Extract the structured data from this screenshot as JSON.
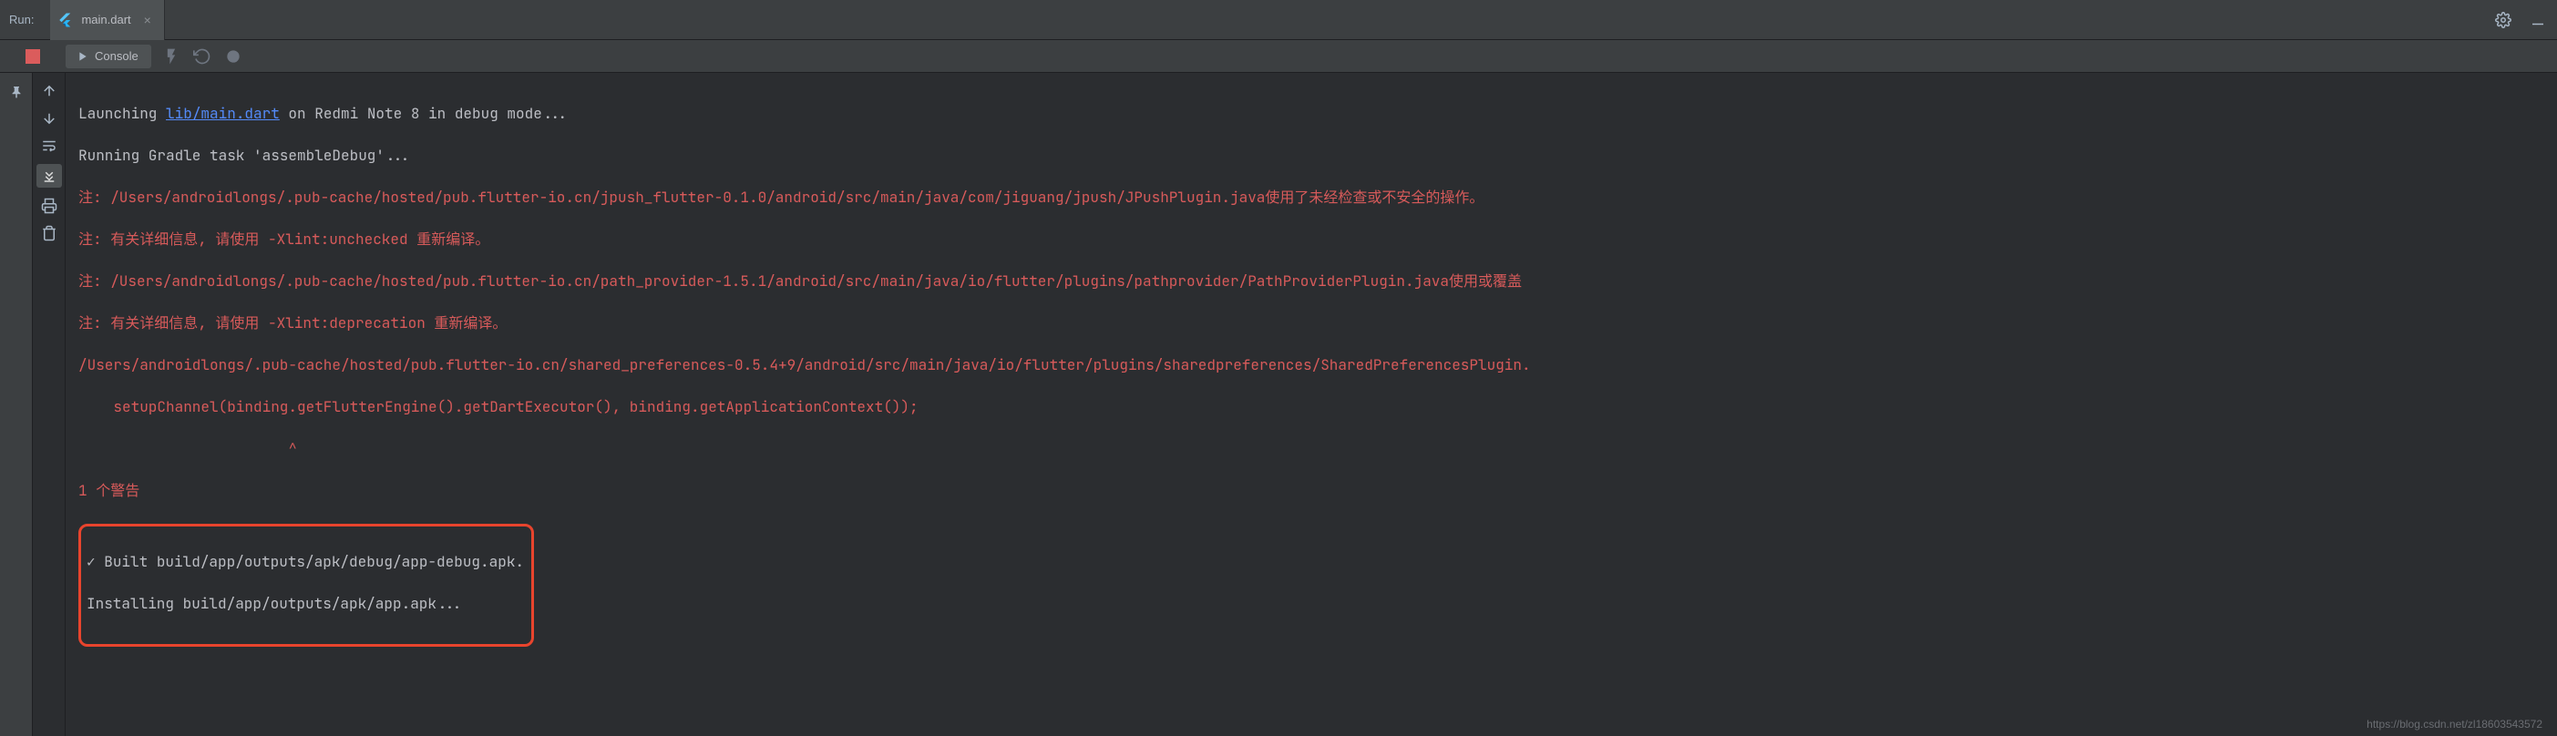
{
  "header": {
    "run_label": "Run:",
    "tab": {
      "name": "main.dart",
      "icon": "flutter-icon"
    }
  },
  "toolbar": {
    "console_label": "Console"
  },
  "console": {
    "lines": {
      "launch_prefix": "Launching ",
      "launch_link": "lib/main.dart",
      "launch_suffix": " on Redmi Note 8 in debug mode...",
      "gradle": "Running Gradle task 'assembleDebug'...",
      "err1": "注: /Users/androidlongs/.pub-cache/hosted/pub.flutter-io.cn/jpush_flutter-0.1.0/android/src/main/java/com/jiguang/jpush/JPushPlugin.java使用了未经检查或不安全的操作。",
      "err2": "注: 有关详细信息, 请使用 -Xlint:unchecked 重新编译。",
      "err3": "注: /Users/androidlongs/.pub-cache/hosted/pub.flutter-io.cn/path_provider-1.5.1/android/src/main/java/io/flutter/plugins/pathprovider/PathProviderPlugin.java使用或覆盖",
      "err4": "注: 有关详细信息, 请使用 -Xlint:deprecation 重新编译。",
      "err5": "/Users/androidlongs/.pub-cache/hosted/pub.flutter-io.cn/shared_preferences-0.5.4+9/android/src/main/java/io/flutter/plugins/sharedpreferences/SharedPreferencesPlugin.",
      "err6": "    setupChannel(binding.getFlutterEngine().getDartExecutor(), binding.getApplicationContext());",
      "err7": "                        ^",
      "err8": "1 个警告",
      "built": "✓ Built build/app/outputs/apk/debug/app-debug.apk.",
      "install": "Installing build/app/outputs/apk/app.apk..."
    }
  },
  "watermark": "https://blog.csdn.net/zl18603543572"
}
